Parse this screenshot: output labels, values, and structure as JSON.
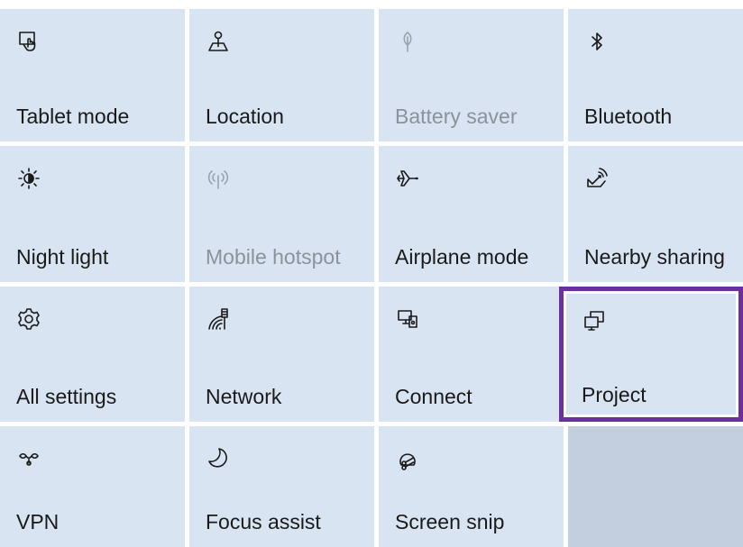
{
  "action_center": {
    "tiles": [
      {
        "label": "Tablet mode",
        "icon": "tablet-mode-icon",
        "state": "on"
      },
      {
        "label": "Location",
        "icon": "location-icon",
        "state": "on"
      },
      {
        "label": "Battery saver",
        "icon": "battery-saver-icon",
        "state": "disabled"
      },
      {
        "label": "Bluetooth",
        "icon": "bluetooth-icon",
        "state": "on"
      },
      {
        "label": "Night light",
        "icon": "night-light-icon",
        "state": "on"
      },
      {
        "label": "Mobile hotspot",
        "icon": "mobile-hotspot-icon",
        "state": "disabled"
      },
      {
        "label": "Airplane mode",
        "icon": "airplane-mode-icon",
        "state": "on"
      },
      {
        "label": "Nearby sharing",
        "icon": "nearby-sharing-icon",
        "state": "on"
      },
      {
        "label": "All settings",
        "icon": "settings-gear-icon",
        "state": "on"
      },
      {
        "label": "Network",
        "icon": "network-icon",
        "state": "on"
      },
      {
        "label": "Connect",
        "icon": "connect-icon",
        "state": "on"
      },
      {
        "label": "Project",
        "icon": "project-icon",
        "state": "selected"
      },
      {
        "label": "VPN",
        "icon": "vpn-icon",
        "state": "on"
      },
      {
        "label": "Focus assist",
        "icon": "focus-assist-moon-icon",
        "state": "on"
      },
      {
        "label": "Screen snip",
        "icon": "screen-snip-icon",
        "state": "on"
      }
    ],
    "colors": {
      "tile_bg": "#d8e4f1",
      "empty_bg": "#c3cfdf",
      "selection_border": "#6b2f9e"
    }
  }
}
